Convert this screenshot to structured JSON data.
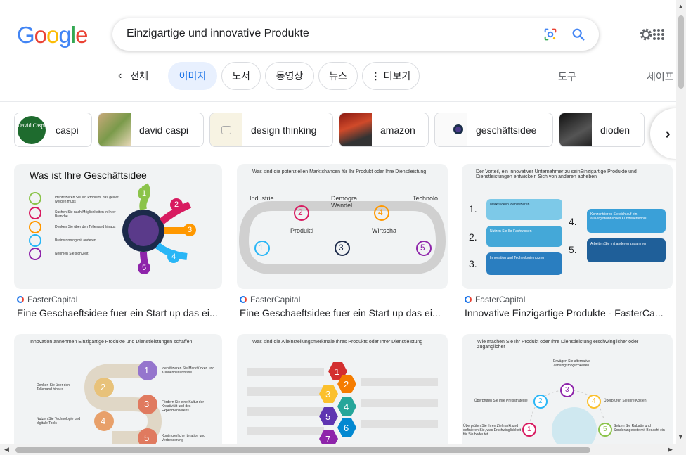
{
  "logo": {
    "letters": [
      "G",
      "o",
      "o",
      "g",
      "l",
      "e"
    ],
    "colors": [
      "#4285F4",
      "#EA4335",
      "#FBBC05",
      "#4285F4",
      "#34A853",
      "#EA4335"
    ]
  },
  "search": {
    "query": "Einzigartige und innovative Produkte"
  },
  "tabs": {
    "back_label": "전체",
    "items": [
      {
        "label": "이미지",
        "active": true
      },
      {
        "label": "도서"
      },
      {
        "label": "동영상"
      },
      {
        "label": "뉴스"
      },
      {
        "label": "더보기"
      }
    ],
    "tools": "도구",
    "safe": "세이프"
  },
  "chips": [
    {
      "label": "caspi",
      "thumb_text": "David Caspi"
    },
    {
      "label": "david caspi"
    },
    {
      "label": "design thinking"
    },
    {
      "label": "amazon"
    },
    {
      "label": "geschäftsidee"
    },
    {
      "label": "dioden"
    }
  ],
  "results": [
    {
      "source": "FasterCapital",
      "caption": "Eine Geschaeftsidee fuer ein Start up das ei...",
      "img_title": "Was ist Ihre Geschäftsidee",
      "img_items": [
        "Identifizieren Sie ein Problem, das gelöst werden muss",
        "Suchen Sie nach Möglichkeiten in Ihrer Branche",
        "Denken Sie über den Tellerrand hinaus",
        "Brainstorming mit anderen",
        "Nehmen Sie sich Zeit"
      ],
      "numbers": [
        "1",
        "2",
        "3",
        "4",
        "5"
      ]
    },
    {
      "source": "FasterCapital",
      "caption": "Eine Geschaeftsidee fuer ein Start up das ei...",
      "img_title": "Was sind die potenziellen Marktchancen für Ihr Produkt oder Ihre Dienstleistung",
      "img_items": [
        "Industrie",
        "Demogra Wandel",
        "Technolo",
        "Produkti",
        "Wirtscha"
      ],
      "numbers": [
        "1",
        "2",
        "3",
        "4",
        "5"
      ]
    },
    {
      "source": "FasterCapital",
      "caption": "Innovative Einzigartige Produkte - FasterCa...",
      "img_title": "Der Vorteil, ein innovativer Unternehmer zu seinEinzigartige Produkte und Dienstleistungen entwickeln Sich von anderen abheben",
      "img_items": [
        "Marktlücken identifizieren",
        "Nutzen Sie Ihr Fachwissen",
        "Innovation und Technologie nutzen",
        "Konzentrieren Sie sich auf ein außergewöhnliches Kundenerlebnis",
        "Arbeiten Sie mit anderen zusammen"
      ],
      "numbers": [
        "1.",
        "2.",
        "3.",
        "4.",
        "5."
      ]
    },
    {
      "source": "",
      "caption": "",
      "img_title": "Innovation annehmen Einzigartige Produkte und Dienstleistungen schaffen",
      "img_items": [
        "Identifizieren Sie Marktlücken und Kundenbedürfnisse",
        "Denken Sie über den Tellerrand hinaus",
        "Fördern Sie eine Kultur der Kreativität und des Experimentierens",
        "Nutzen Sie Technologie und digitale Tools",
        "Kontinuierliche Iteration und Verbesserung"
      ],
      "numbers": [
        "1",
        "2",
        "3",
        "4",
        "5"
      ]
    },
    {
      "source": "",
      "caption": "",
      "img_title": "Was sind die Alleinstellungsmerkmale Ihres Produkts oder Ihrer Dienstleistung",
      "img_items": [],
      "numbers": [
        "1",
        "2",
        "3",
        "4",
        "5",
        "6",
        "7"
      ]
    },
    {
      "source": "",
      "caption": "",
      "img_title": "Wie machen Sie Ihr Produkt oder Ihre Dienstleistung erschwinglicher oder zugänglicher",
      "img_items": [
        "Erwägen Sie alternative Zahlungsmöglichkeiten",
        "Überprüfen Sie Ihre Preisstrategie",
        "Überprüfen Sie Ihre Kosten",
        "Überprüfen Sie Ihren Zielmarkt und definieren Sie, was Erschwinglichkeit für Sie bedeutet",
        "Setzen Sie Rabatte und Sonderangebote mit Bedacht ein"
      ],
      "numbers": [
        "1",
        "2",
        "3",
        "4",
        "5"
      ]
    }
  ]
}
